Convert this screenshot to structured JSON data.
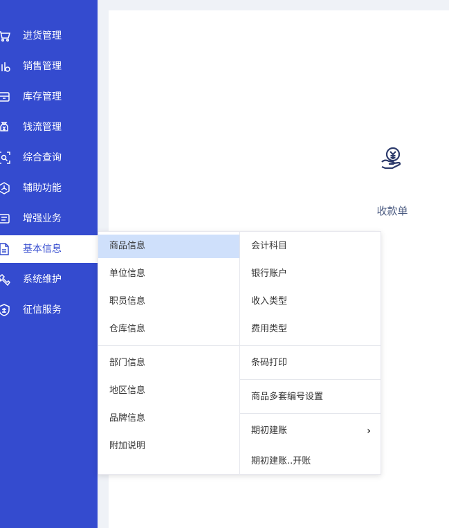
{
  "sidebar": {
    "items": [
      {
        "label": "进货管理",
        "icon": "cart-icon"
      },
      {
        "label": "销售管理",
        "icon": "sales-chart-icon"
      },
      {
        "label": "库存管理",
        "icon": "inventory-box-icon"
      },
      {
        "label": "钱流管理",
        "icon": "money-bag-icon"
      },
      {
        "label": "综合查询",
        "icon": "search-scan-icon"
      },
      {
        "label": "辅助功能",
        "icon": "cube-icon"
      },
      {
        "label": "增强业务",
        "icon": "document-list-icon"
      },
      {
        "label": "基本信息",
        "icon": "file-icon",
        "active": true
      },
      {
        "label": "系统维护",
        "icon": "wrench-icon"
      },
      {
        "label": "征信服务",
        "icon": "credit-shield-icon"
      }
    ]
  },
  "main": {
    "shortcut": {
      "label": "收款单",
      "icon": "receipt-money-hand-icon"
    }
  },
  "submenu": {
    "left": [
      {
        "label": "商品信息",
        "selected": true
      },
      {
        "label": "单位信息"
      },
      {
        "label": "职员信息"
      },
      {
        "label": "仓库信息"
      },
      {
        "label": "部门信息"
      },
      {
        "label": "地区信息"
      },
      {
        "label": "品牌信息"
      },
      {
        "label": "附加说明"
      }
    ],
    "right": [
      {
        "label": "会计科目"
      },
      {
        "label": "银行账户"
      },
      {
        "label": "收入类型"
      },
      {
        "label": "费用类型"
      },
      {
        "label": "条码打印"
      },
      {
        "label": "商品多套编号设置"
      },
      {
        "label": "期初建账"
      },
      {
        "label": "期初建账..开账"
      }
    ],
    "chevron": "›"
  },
  "colors": {
    "sidebar_bg": "#344bcf",
    "selected_bg": "#cfe0fb",
    "page_bg": "#eff2f7"
  }
}
